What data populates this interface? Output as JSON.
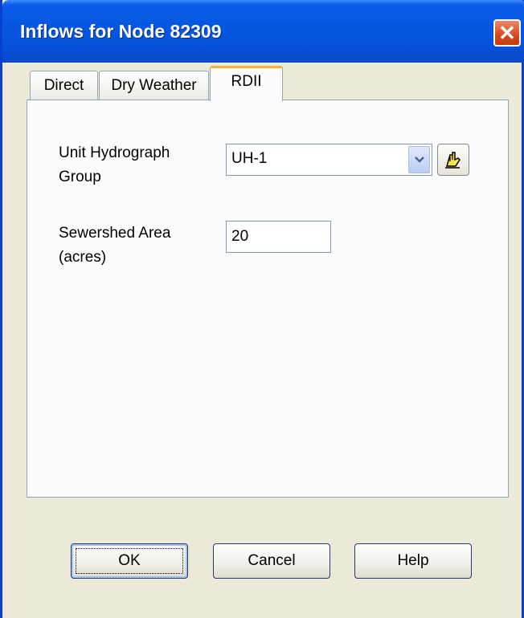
{
  "window": {
    "title": "Inflows for Node 82309",
    "close_symbol": "✕"
  },
  "tabs": [
    {
      "label": "Direct",
      "active": false
    },
    {
      "label": "Dry Weather",
      "active": false
    },
    {
      "label": "RDII",
      "active": true
    }
  ],
  "rdii": {
    "unit_hydrograph_label_line1": "Unit Hydrograph",
    "unit_hydrograph_label_line2": "Group",
    "unit_hydrograph_value": "UH-1",
    "sewershed_label_line1": "Sewershed Area",
    "sewershed_label_line2": "(acres)",
    "sewershed_value": "20"
  },
  "buttons": {
    "ok": "OK",
    "cancel": "Cancel",
    "help": "Help"
  },
  "colors": {
    "titlebar": "#0657e0",
    "close": "#d8481f",
    "active_tab_accent": "#f6b33b",
    "dialog_bg": "#ece9d8"
  },
  "icons": {
    "dropdown": "chevron-down-icon",
    "edit": "pencil-hand-icon",
    "close": "close-icon"
  }
}
